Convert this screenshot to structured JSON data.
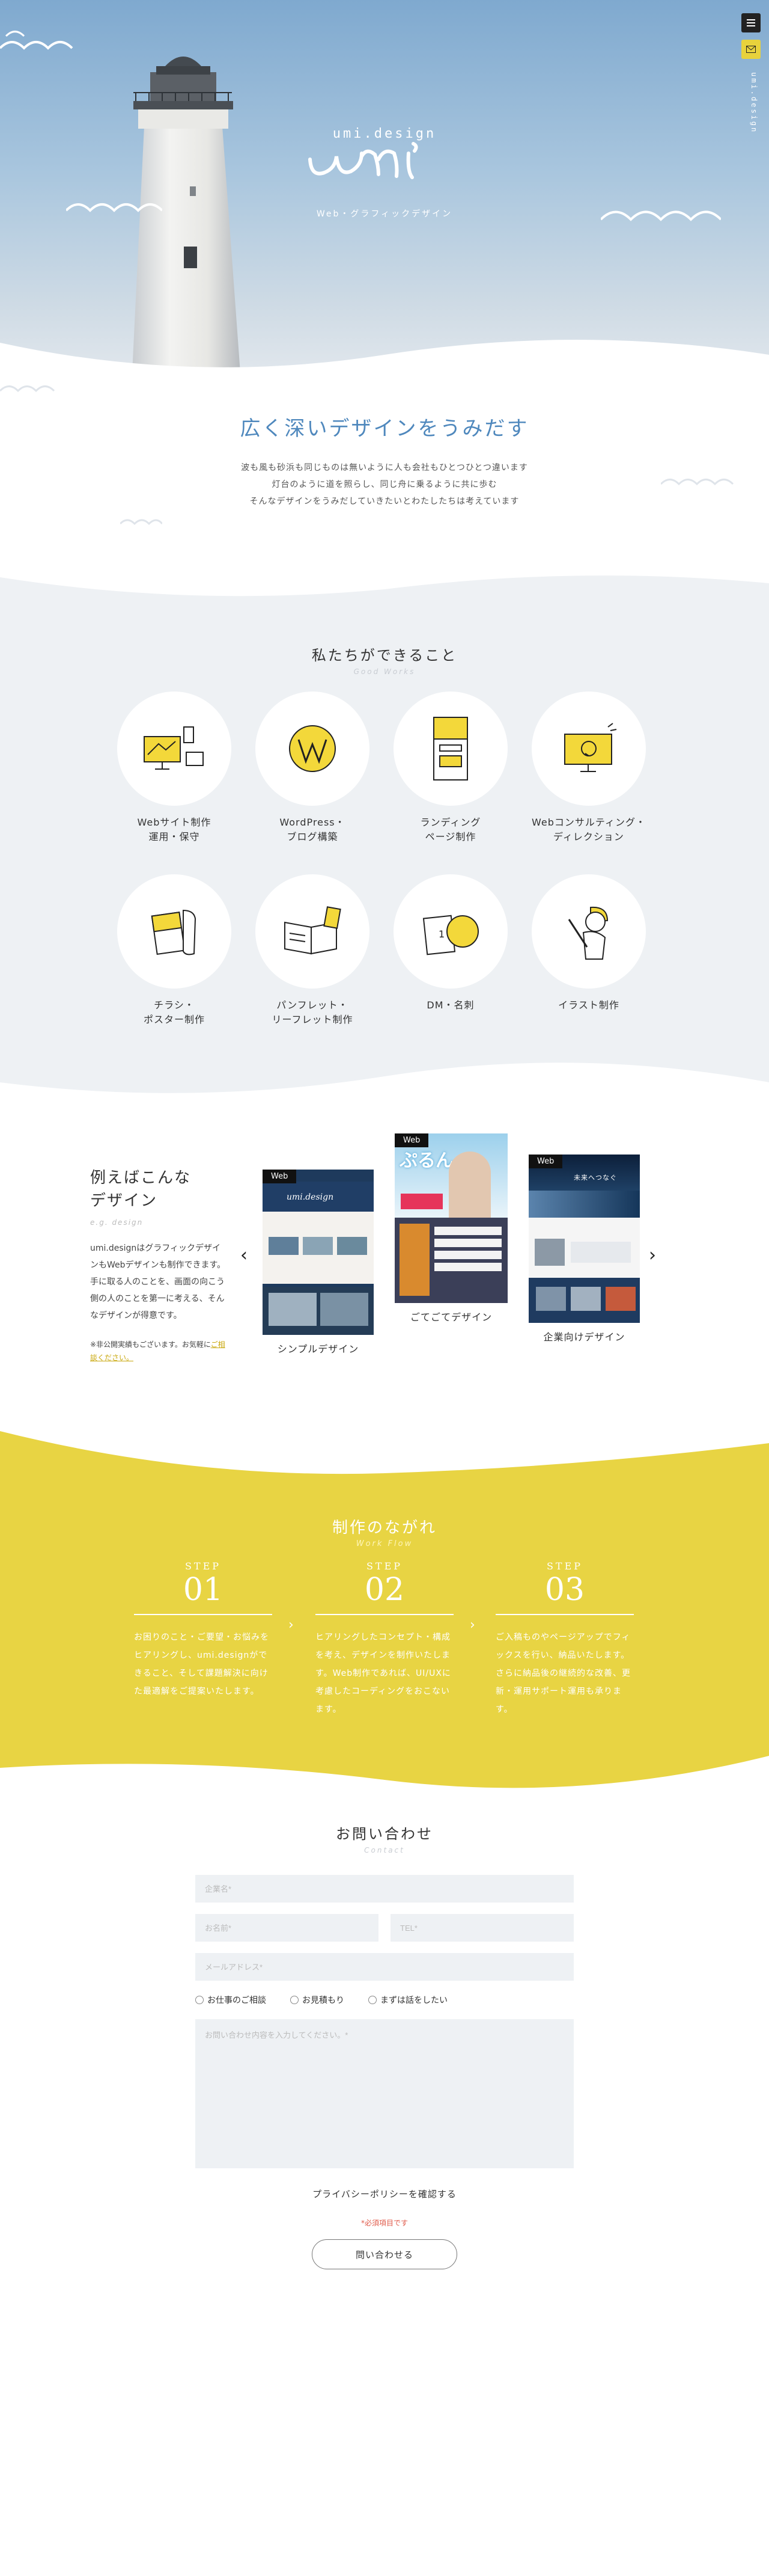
{
  "header": {
    "brand": "umi.design",
    "tagline": "Web・グラフィックデザイン",
    "side_text": "umi.design",
    "menu_icon": "hamburger-menu-icon",
    "mail_icon": "mail-icon"
  },
  "intro": {
    "title": "広く深いデザインをうみだす",
    "lines": [
      "波も風も砂浜も同じものは無いように人も会社もひとつひとつ違います",
      "灯台のように道を照らし、同じ舟に乗るように共に歩む",
      "そんなデザインをうみだしていきたいとわたしたちは考えています"
    ]
  },
  "services": {
    "title": "私たちができること",
    "subtitle": "Good Works",
    "items": [
      {
        "label": "Webサイト制作\n運用・保守",
        "icon": "computer-devices-icon"
      },
      {
        "label": "WordPress・\nブログ構築",
        "icon": "wordpress-icon"
      },
      {
        "label": "ランディング\nページ制作",
        "icon": "landing-page-icon"
      },
      {
        "label": "Webコンサルティング・\nディレクション",
        "icon": "consulting-monitor-icon"
      },
      {
        "label": "チラシ・\nポスター制作",
        "icon": "flyer-poster-icon"
      },
      {
        "label": "パンフレット・\nリーフレット制作",
        "icon": "pamphlet-icon"
      },
      {
        "label": "DM・名刺",
        "icon": "business-card-icon"
      },
      {
        "label": "イラスト制作",
        "icon": "illustration-icon"
      }
    ]
  },
  "examples": {
    "title": "例えばこんな\nデザイン",
    "subtitle": "e.g. design",
    "description": "umi.designはグラフィックデザインもWebデザインも制作できます。手に取る人のことを、画面の向こう側の人のことを第一に考える、そんなデザインが得意です。",
    "note_prefix": "※非公開実績もございます。お気軽に",
    "note_link": "ご相談ください。",
    "cards": [
      {
        "tag": "Web",
        "caption": "シンプルデザイン",
        "hero_text": "umi.design"
      },
      {
        "tag": "Web",
        "caption": "ごてごてデザイン",
        "hero_text": "ぷるん"
      },
      {
        "tag": "Web",
        "caption": "企業向けデザイン",
        "hero_text": "未来へつなぐ"
      }
    ]
  },
  "flow": {
    "title": "制作のながれ",
    "subtitle": "Work Flow",
    "steps": [
      {
        "label": "STEP",
        "num": "01",
        "text": "お困りのこと・ご要望・お悩みをヒアリングし、umi.designができること、そして課題解決に向けた最適解をご提案いたします。"
      },
      {
        "label": "STEP",
        "num": "02",
        "text": "ヒアリングしたコンセプト・構成を考え、デザインを制作いたします。Web制作であれば、UI/UXに考慮したコーディングをおこないます。"
      },
      {
        "label": "STEP",
        "num": "03",
        "text": "ご入稿ものやページアップでフィックスを行い、納品いたします。さらに納品後の継続的な改善、更新・運用サポート運用も承ります。"
      }
    ]
  },
  "contact": {
    "title": "お問い合わせ",
    "subtitle": "Contact",
    "company_placeholder": "企業名*",
    "name_placeholder": "お名前*",
    "tel_placeholder": "TEL*",
    "email_placeholder": "メールアドレス*",
    "radio_options": [
      "お仕事のご相談",
      "お見積もり",
      "まずは話をしたい"
    ],
    "message_placeholder": "お問い合わせ内容を入力してください。*",
    "privacy": "プライバシーポリシーを確認する",
    "required": "*必須項目です",
    "submit": "問い合わせる"
  }
}
